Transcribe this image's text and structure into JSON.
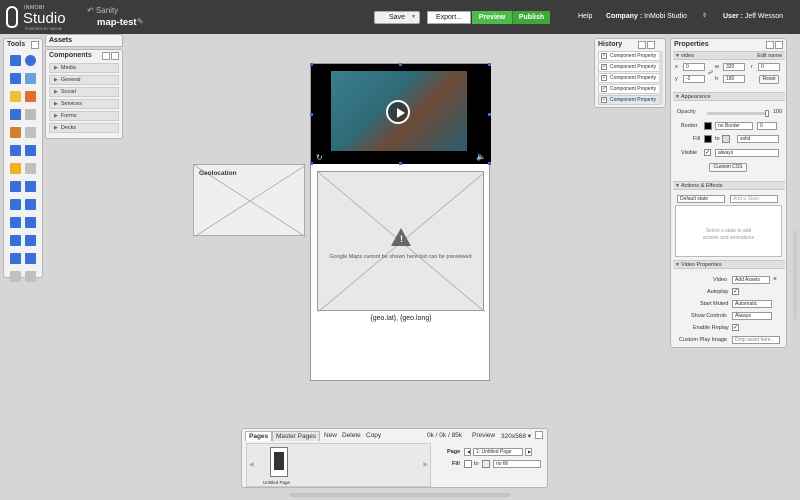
{
  "header": {
    "brand": "INMOBI",
    "product": "Studio",
    "tagline": "POWERED BY INMOBI",
    "back_link": "Sanity",
    "project_name": "map-test",
    "save_label": "Save",
    "export_label": "Export...",
    "preview_label": "Preview",
    "publish_label": "Publish",
    "help_label": "Help",
    "company_label": "Company :",
    "company_name": "InMobi Studio",
    "user_label": "User :",
    "user_name": "Jeff Wesson"
  },
  "tools": {
    "title": "Tools",
    "items": [
      {
        "icon": "rectangle-icon",
        "color": "#3a6fd8"
      },
      {
        "icon": "circle-icon",
        "color": "#3a6fd8"
      },
      {
        "icon": "text-icon",
        "color": "#3a6fd8"
      },
      {
        "icon": "image-icon",
        "color": "#6aa0e0"
      },
      {
        "icon": "speech-bubble-icon",
        "color": "#f0c030"
      },
      {
        "icon": "video-icon",
        "color": "#e07030"
      },
      {
        "icon": "undo-icon",
        "color": "#3a6fd8"
      },
      {
        "icon": "redo-icon",
        "color": "#bbbbbb"
      },
      {
        "icon": "group-icon",
        "color": "#d08030"
      },
      {
        "icon": "ungroup-icon",
        "color": "#c0c0c0"
      },
      {
        "icon": "send-back-icon",
        "color": "#3a6fd8"
      },
      {
        "icon": "bring-front-icon",
        "color": "#3a6fd8"
      },
      {
        "icon": "lock-icon",
        "color": "#f0b020"
      },
      {
        "icon": "unlock-icon",
        "color": "#c0c0c0"
      },
      {
        "icon": "flip-horizontal-icon",
        "color": "#3a6fd8"
      },
      {
        "icon": "flip-vertical-icon",
        "color": "#3a6fd8"
      },
      {
        "icon": "rotate-left-icon",
        "color": "#3a6fd8"
      },
      {
        "icon": "rotate-right-icon",
        "color": "#3a6fd8"
      },
      {
        "icon": "align-left-icon",
        "color": "#3a6fd8"
      },
      {
        "icon": "align-right-icon",
        "color": "#3a6fd8"
      },
      {
        "icon": "align-top-icon",
        "color": "#3a6fd8"
      },
      {
        "icon": "align-bottom-icon",
        "color": "#3a6fd8"
      },
      {
        "icon": "distribute-h-icon",
        "color": "#3a6fd8"
      },
      {
        "icon": "distribute-v-icon",
        "color": "#3a6fd8"
      },
      {
        "icon": "crop-icon",
        "color": "#c0c0c0"
      },
      {
        "icon": "settings-icon",
        "color": "#c0c0c0"
      }
    ]
  },
  "assets": {
    "tab_label": "Assets",
    "components_title": "Components",
    "items": [
      "Media",
      "General",
      "Social",
      "Services",
      "Forms",
      "Decks"
    ]
  },
  "canvas": {
    "geolocation_label": "Geolocation",
    "map_message": "Google Maps cannot be shown here but can be previewed",
    "coords": "{geo.lat}, {geo.long}"
  },
  "history": {
    "title": "History",
    "items": [
      "Component Property",
      "Component Property",
      "Component Property",
      "Component Property",
      "Component Property"
    ]
  },
  "properties": {
    "title": "Properties",
    "component_name": "video",
    "edit_name": "Edit name",
    "x_label": "x",
    "x_value": "0",
    "y_label": "y",
    "y_value": "-2",
    "w_label": "w",
    "w_value": "320",
    "h_label": "h",
    "h_value": "180",
    "r_label": "r",
    "r_value": "0",
    "reset_label": "Reset",
    "appearance": "Appearance",
    "opacity_label": "Opacity",
    "opacity_value": "100",
    "border_label": "Border",
    "border_value": "no Border",
    "border_width": "0",
    "fill_label": "Fill",
    "fill_to": "to",
    "fill_value": "solid",
    "visible_label": "Visible",
    "visible_value": "always",
    "custom_css": "Custom CSS",
    "actions_title": "Actions & Effects",
    "default_state": "Default state",
    "add_state": "Add a State",
    "actions_msg_line1": "Select a state to add",
    "actions_msg_line2": "actions and animations",
    "video_props_title": "Video Properties",
    "video_label": "Video",
    "video_value": "Add Assets",
    "autoplay_label": "Autoplay",
    "start_muted_label": "Start Muted",
    "start_muted_value": "Automatic",
    "show_controls_label": "Show Controls",
    "show_controls_value": "Always",
    "enable_replay_label": "Enable Replay",
    "custom_play_label": "Custom Play Image",
    "custom_play_value": "Drop asset here..."
  },
  "pages": {
    "tab_pages": "Pages",
    "tab_master": "Master Pages",
    "new_label": "New",
    "delete_label": "Delete",
    "copy_label": "Copy",
    "stats": "0k / 0k / 85k",
    "preview_label": "Preview",
    "size_label": "320x568",
    "thumb_label": "Untitled Page",
    "page_label": "Page",
    "page_value": "1: Untitled Page",
    "fill_label": "Fill",
    "fill_to": "to",
    "fill_value": "no fill"
  }
}
